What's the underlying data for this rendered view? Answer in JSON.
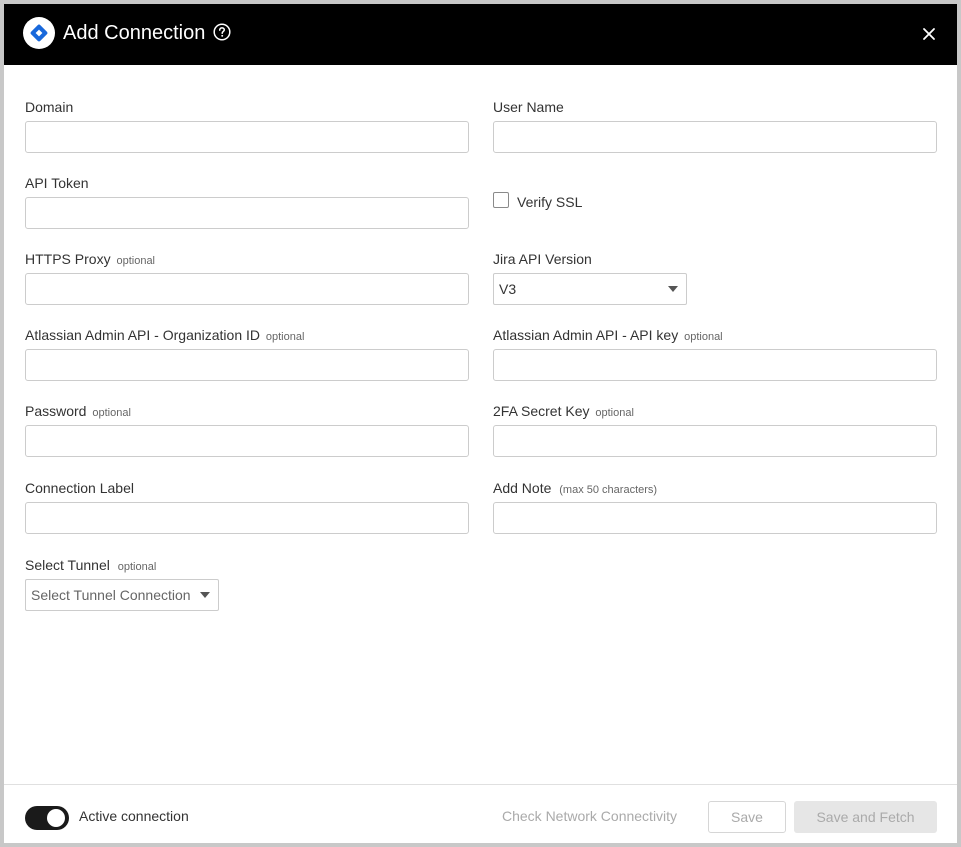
{
  "dialog": {
    "title": "Add Connection",
    "brand_color": "#1868db",
    "header_bg": "#000000"
  },
  "form": {
    "domain": {
      "label": "Domain",
      "value": ""
    },
    "user_name": {
      "label": "User Name",
      "value": ""
    },
    "api_token": {
      "label": "API Token",
      "value": ""
    },
    "verify_ssl": {
      "label": "Verify SSL",
      "checked": false
    },
    "https_proxy": {
      "label": "HTTPS Proxy",
      "optional": "optional",
      "value": ""
    },
    "jira_api_version": {
      "label": "Jira API Version",
      "selected": "V3"
    },
    "org_id": {
      "label": "Atlassian Admin API - Organization ID",
      "optional": "optional",
      "value": ""
    },
    "admin_api_key": {
      "label": "Atlassian Admin API - API key",
      "optional": "optional",
      "value": ""
    },
    "password": {
      "label": "Password",
      "optional": "optional",
      "value": ""
    },
    "secret_key": {
      "label": "2FA Secret Key",
      "optional": "optional",
      "value": ""
    },
    "connection_label": {
      "label": "Connection Label",
      "value": ""
    },
    "add_note": {
      "label": "Add Note",
      "hint": "(max 50 characters)",
      "value": ""
    },
    "select_tunnel": {
      "label": "Select Tunnel",
      "optional": "optional",
      "placeholder": "Select Tunnel Connection"
    }
  },
  "footer": {
    "active_label": "Active connection",
    "active": true,
    "check_network": "Check Network Connectivity",
    "save": "Save",
    "save_fetch": "Save and Fetch"
  }
}
